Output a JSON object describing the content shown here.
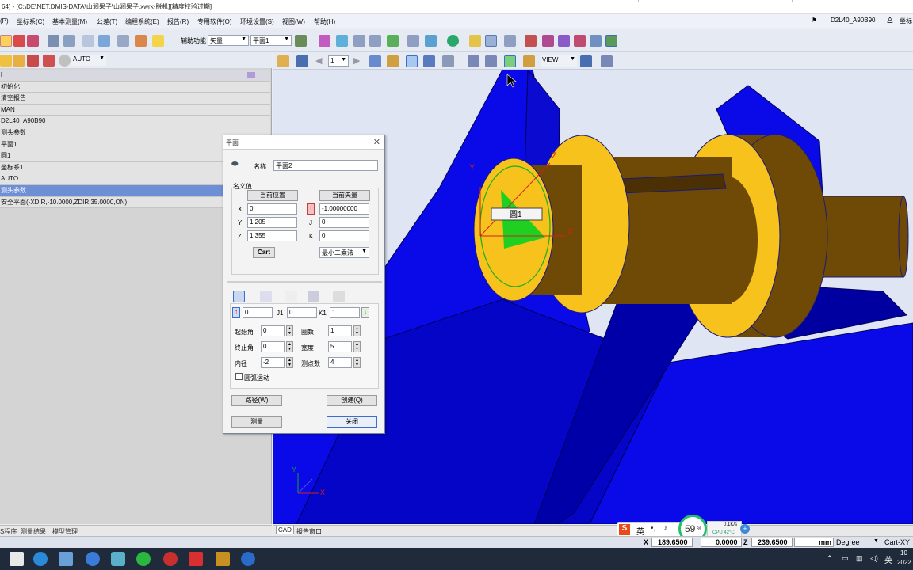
{
  "window": {
    "title": "64) - [C:\\DE\\NET.DMIS-DATA\\山涧果子\\山涧果子.xwrk-脱机][精度校验过期]"
  },
  "menu": {
    "items": [
      "(P)",
      "坐标系(C)",
      "基本测量(M)",
      "公差(T)",
      "编程系统(E)",
      "报告(R)",
      "专用软件(O)",
      "环境设置(S)",
      "视图(W)",
      "帮助(H)"
    ],
    "probe_label": "D2L40_A90B90",
    "coord_label": "坐标"
  },
  "toolbar": {
    "aux_label": "辅助功能",
    "aux_value": "矢量",
    "plane_value": "平面1"
  },
  "left_toolbar": {
    "mode_value": "AUTO"
  },
  "tree": {
    "header_suffix": "l",
    "rows": [
      "初始化",
      "清空报告",
      "MAN",
      "D2L40_A90B90",
      "测头参数",
      "平面1",
      "圆1",
      "坐标系1",
      "AUTO",
      "测头参数",
      "安全平面(-XDIR,-10.0000,ZDIR,35.0000,ON)"
    ],
    "selected_index": 9
  },
  "left_tabs": [
    "S程序",
    "测量结果",
    "模型管理"
  ],
  "viewport_toolbar": {
    "page_value": "1",
    "view_value": "VIEW"
  },
  "viewport_tabs": [
    "CAD",
    "报告窗口"
  ],
  "cad": {
    "label_text": "圆1",
    "axis_x": "X",
    "axis_y": "Y",
    "axis_z": "Z"
  },
  "dialog": {
    "title": "平面",
    "name_label": "名称",
    "name_value": "平面2",
    "nominal_label": "名义值",
    "cur_pos_btn": "当前位置",
    "cur_vec_btn": "当前矢量",
    "x_label": "X",
    "y_label": "Y",
    "z_label": "Z",
    "i_label": "I",
    "j_label": "J",
    "k_label": "K",
    "x_value": "0",
    "y_value": "1.205",
    "z_value": "1.355",
    "i_value": "-1.00000000",
    "j_value": "0",
    "k_value": "0",
    "cart_btn": "Cart",
    "method_value": "最小二乘法",
    "i1_value": "0",
    "j1_label": "J1",
    "j1_value": "0",
    "k1_label": "K1",
    "k1_value": "1",
    "start_angle_label": "起始角",
    "start_angle_value": "0",
    "turns_label": "圈数",
    "turns_value": "1",
    "end_angle_label": "终止角",
    "end_angle_value": "0",
    "width_label": "宽度",
    "width_value": "5",
    "inner_label": "内径",
    "inner_value": "-2",
    "points_label": "测点数",
    "points_value": "4",
    "arc_label": "圆弧运动",
    "path_btn": "路径(W)",
    "create_btn": "创建(Q)",
    "measure_btn": "测量",
    "close_btn": "关闭"
  },
  "status": {
    "x_label": "X",
    "x_value": "189.6500",
    "y_value": "0.0000",
    "z_label": "Z",
    "z_value": "239.6500",
    "unit": "mm",
    "angle_unit": "Degree",
    "coord_mode": "Cart-XY"
  },
  "hud": {
    "ime_lang": "英",
    "cpu_percent": "59",
    "cpu_symbol": "%",
    "net_speed": "0.1K/s",
    "cpu_temp": "CPU 42°C"
  },
  "taskbar": {
    "tray_lang": "英",
    "clock_top": "10",
    "clock_bottom": "2022"
  },
  "colors": {
    "blue_part": "#0a0ae8",
    "gold": "#f7c21c",
    "brown": "#6f4a06",
    "selection": "#6d8fd6"
  }
}
